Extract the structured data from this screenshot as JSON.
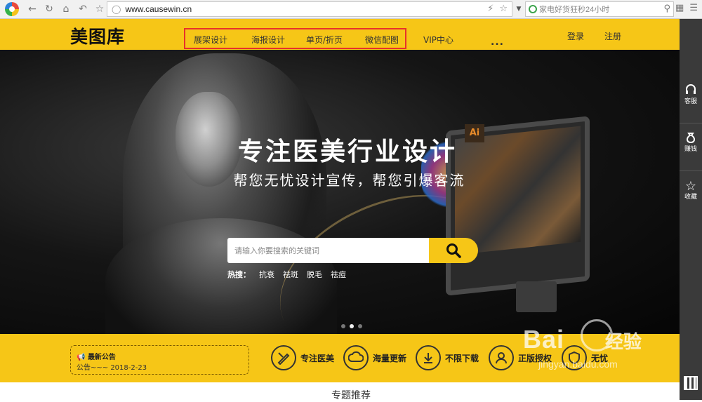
{
  "browser": {
    "url": "www.causewin.cn",
    "search_placeholder": "家电好货狂秒24小时"
  },
  "site": {
    "logo": "美图库",
    "nav": [
      "展架设计",
      "海报设计",
      "单页/折页",
      "微信配图",
      "VIP中心"
    ],
    "more": "...",
    "login": "登录",
    "register": "注册"
  },
  "banner": {
    "headline": "专注医美行业设计",
    "subline": "帮您无忧设计宣传，帮您引爆客流",
    "search_placeholder": "请输入你要搜索的关键词",
    "hot_label": "热搜：",
    "hot_keywords": [
      "抗衰",
      "祛斑",
      "脱毛",
      "祛痘"
    ],
    "badge": "Ai",
    "carousel_count": 3,
    "carousel_active": 2
  },
  "notice": {
    "title": "最新公告",
    "text": "公告~~~ 2018-2-23"
  },
  "features": [
    {
      "label": "专注医美",
      "icon": "pen-ruler-icon"
    },
    {
      "label": "海量更新",
      "icon": "cloud-sync-icon"
    },
    {
      "label": "不限下载",
      "icon": "download-icon"
    },
    {
      "label": "正版授权",
      "icon": "user-icon"
    },
    {
      "label": "无忧",
      "icon": "shield-icon"
    }
  ],
  "section": {
    "title": "专题推荐"
  },
  "sidebar": [
    {
      "label": "客服",
      "icon": "headset-icon"
    },
    {
      "label": "赚钱",
      "icon": "money-bag-icon"
    },
    {
      "label": "收藏",
      "icon": "star-icon"
    }
  ],
  "watermark": {
    "text": "Bai",
    "cn": "经验",
    "url": "jingyan.baidu.com"
  },
  "colors": {
    "brand_yellow": "#f6c617",
    "highlight_red": "#e8312b",
    "sidebar_dark": "#3a3a3a"
  }
}
